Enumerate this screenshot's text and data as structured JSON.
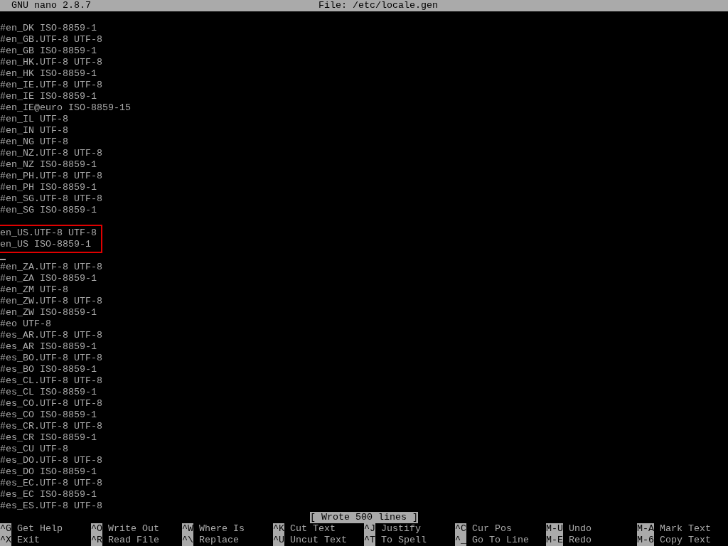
{
  "title_bar": {
    "app": "GNU nano 2.8.7",
    "file": "File: /etc/locale.gen"
  },
  "lines": [
    {
      "kind": "text",
      "text": "#en_DK ISO-8859-1",
      "highlighted": false
    },
    {
      "kind": "text",
      "text": "#en_GB.UTF-8 UTF-8",
      "highlighted": false
    },
    {
      "kind": "text",
      "text": "#en_GB ISO-8859-1",
      "highlighted": false
    },
    {
      "kind": "text",
      "text": "#en_HK.UTF-8 UTF-8",
      "highlighted": false
    },
    {
      "kind": "text",
      "text": "#en_HK ISO-8859-1",
      "highlighted": false
    },
    {
      "kind": "text",
      "text": "#en_IE.UTF-8 UTF-8",
      "highlighted": false
    },
    {
      "kind": "text",
      "text": "#en_IE ISO-8859-1",
      "highlighted": false
    },
    {
      "kind": "text",
      "text": "#en_IE@euro ISO-8859-15",
      "highlighted": false
    },
    {
      "kind": "text",
      "text": "#en_IL UTF-8",
      "highlighted": false
    },
    {
      "kind": "text",
      "text": "#en_IN UTF-8",
      "highlighted": false
    },
    {
      "kind": "text",
      "text": "#en_NG UTF-8",
      "highlighted": false
    },
    {
      "kind": "text",
      "text": "#en_NZ.UTF-8 UTF-8",
      "highlighted": false
    },
    {
      "kind": "text",
      "text": "#en_NZ ISO-8859-1",
      "highlighted": false
    },
    {
      "kind": "text",
      "text": "#en_PH.UTF-8 UTF-8",
      "highlighted": false
    },
    {
      "kind": "text",
      "text": "#en_PH ISO-8859-1",
      "highlighted": false
    },
    {
      "kind": "text",
      "text": "#en_SG.UTF-8 UTF-8",
      "highlighted": false
    },
    {
      "kind": "text",
      "text": "#en_SG ISO-8859-1",
      "highlighted": false
    },
    {
      "kind": "blank"
    },
    {
      "kind": "text",
      "text": "en_US.UTF-8 UTF-8",
      "highlighted": true
    },
    {
      "kind": "text",
      "text": "en_US ISO-8859-1",
      "highlighted": true
    },
    {
      "kind": "cursor"
    },
    {
      "kind": "text",
      "text": "#en_ZA.UTF-8 UTF-8",
      "highlighted": false
    },
    {
      "kind": "text",
      "text": "#en_ZA ISO-8859-1",
      "highlighted": false
    },
    {
      "kind": "text",
      "text": "#en_ZM UTF-8",
      "highlighted": false
    },
    {
      "kind": "text",
      "text": "#en_ZW.UTF-8 UTF-8",
      "highlighted": false
    },
    {
      "kind": "text",
      "text": "#en_ZW ISO-8859-1",
      "highlighted": false
    },
    {
      "kind": "text",
      "text": "#eo UTF-8",
      "highlighted": false
    },
    {
      "kind": "text",
      "text": "#es_AR.UTF-8 UTF-8",
      "highlighted": false
    },
    {
      "kind": "text",
      "text": "#es_AR ISO-8859-1",
      "highlighted": false
    },
    {
      "kind": "text",
      "text": "#es_BO.UTF-8 UTF-8",
      "highlighted": false
    },
    {
      "kind": "text",
      "text": "#es_BO ISO-8859-1",
      "highlighted": false
    },
    {
      "kind": "text",
      "text": "#es_CL.UTF-8 UTF-8",
      "highlighted": false
    },
    {
      "kind": "text",
      "text": "#es_CL ISO-8859-1",
      "highlighted": false
    },
    {
      "kind": "text",
      "text": "#es_CO.UTF-8 UTF-8",
      "highlighted": false
    },
    {
      "kind": "text",
      "text": "#es_CO ISO-8859-1",
      "highlighted": false
    },
    {
      "kind": "text",
      "text": "#es_CR.UTF-8 UTF-8",
      "highlighted": false
    },
    {
      "kind": "text",
      "text": "#es_CR ISO-8859-1",
      "highlighted": false
    },
    {
      "kind": "text",
      "text": "#es_CU UTF-8",
      "highlighted": false
    },
    {
      "kind": "text",
      "text": "#es_DO.UTF-8 UTF-8",
      "highlighted": false
    },
    {
      "kind": "text",
      "text": "#es_DO ISO-8859-1",
      "highlighted": false
    },
    {
      "kind": "text",
      "text": "#es_EC.UTF-8 UTF-8",
      "highlighted": false
    },
    {
      "kind": "text",
      "text": "#es_EC ISO-8859-1",
      "highlighted": false
    },
    {
      "kind": "text",
      "text": "#es_ES.UTF-8 UTF-8",
      "highlighted": false
    }
  ],
  "status": "[ Wrote 500 lines ]",
  "shortcuts": [
    [
      {
        "key": "^G",
        "label": "Get Help"
      },
      {
        "key": "^X",
        "label": "Exit"
      }
    ],
    [
      {
        "key": "^O",
        "label": "Write Out"
      },
      {
        "key": "^R",
        "label": "Read File"
      }
    ],
    [
      {
        "key": "^W",
        "label": "Where Is"
      },
      {
        "key": "^\\",
        "label": "Replace"
      }
    ],
    [
      {
        "key": "^K",
        "label": "Cut Text"
      },
      {
        "key": "^U",
        "label": "Uncut Text"
      }
    ],
    [
      {
        "key": "^J",
        "label": "Justify"
      },
      {
        "key": "^T",
        "label": "To Spell"
      }
    ],
    [
      {
        "key": "^C",
        "label": "Cur Pos"
      },
      {
        "key": "^_",
        "label": "Go To Line"
      }
    ],
    [
      {
        "key": "M-U",
        "label": "Undo"
      },
      {
        "key": "M-E",
        "label": "Redo"
      }
    ],
    [
      {
        "key": "M-A",
        "label": "Mark Text"
      },
      {
        "key": "M-6",
        "label": "Copy Text"
      }
    ]
  ]
}
